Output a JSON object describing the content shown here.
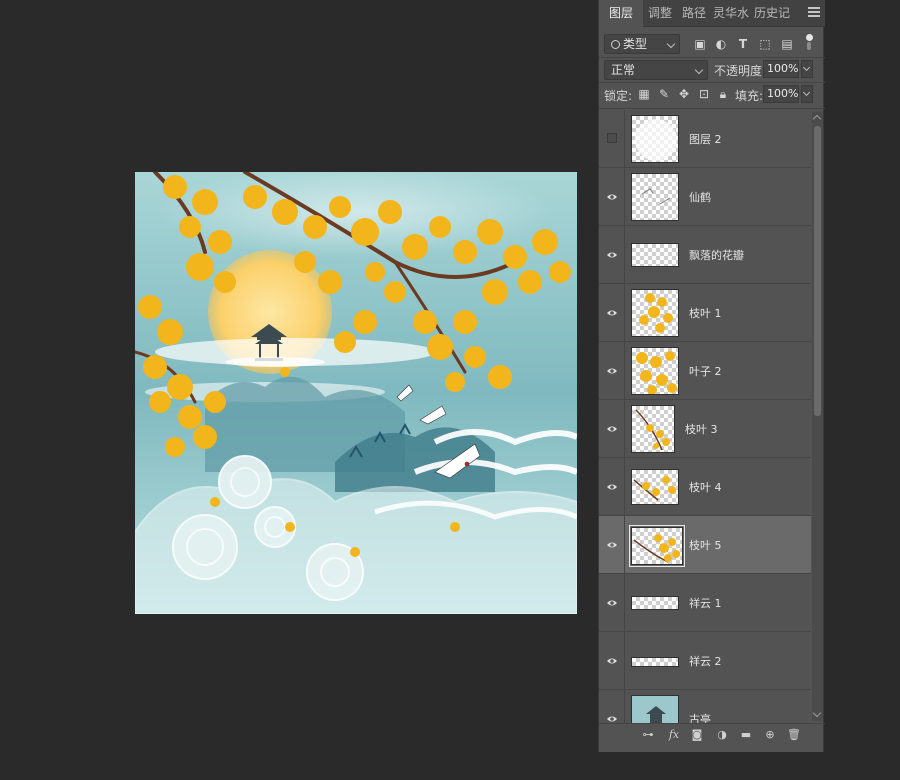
{
  "panel": {
    "tabs": [
      {
        "label": "图层",
        "active": true
      },
      {
        "label": "调整",
        "active": false
      },
      {
        "label": "路径",
        "active": false
      },
      {
        "label": "灵华水",
        "active": false
      },
      {
        "label": "历史记",
        "active": false
      }
    ],
    "filter": {
      "value": "类型"
    },
    "blend_mode": {
      "value": "正常"
    },
    "opacity": {
      "label": "不透明度:",
      "value": "100%"
    },
    "lock": {
      "label": "锁定:"
    },
    "fill": {
      "label": "填充:",
      "value": "100%"
    }
  },
  "layers": [
    {
      "name": "图层 2",
      "visible": false,
      "selected": false
    },
    {
      "name": "仙鹤",
      "visible": true,
      "selected": false
    },
    {
      "name": "飘落的花瓣",
      "visible": true,
      "selected": false
    },
    {
      "name": "枝叶 1",
      "visible": true,
      "selected": false
    },
    {
      "name": "叶子 2",
      "visible": true,
      "selected": false
    },
    {
      "name": "枝叶 3",
      "visible": true,
      "selected": false
    },
    {
      "name": "枝叶 4",
      "visible": true,
      "selected": false
    },
    {
      "name": "枝叶 5",
      "visible": true,
      "selected": true
    },
    {
      "name": "祥云 1",
      "visible": true,
      "selected": false
    },
    {
      "name": "祥云 2",
      "visible": true,
      "selected": false
    },
    {
      "name": "古亭",
      "visible": true,
      "selected": false
    }
  ],
  "icons": {
    "search": "search-icon",
    "eye": "eye-icon",
    "menu": "panel-menu-icon"
  },
  "colors": {
    "app_bg": "#2a2a2a",
    "panel_bg": "#535353",
    "selected_layer": "#6a6a6a",
    "sky": "#8fc3c8",
    "ginkgo": "#f2b51c",
    "sun": "#fbd77a"
  }
}
